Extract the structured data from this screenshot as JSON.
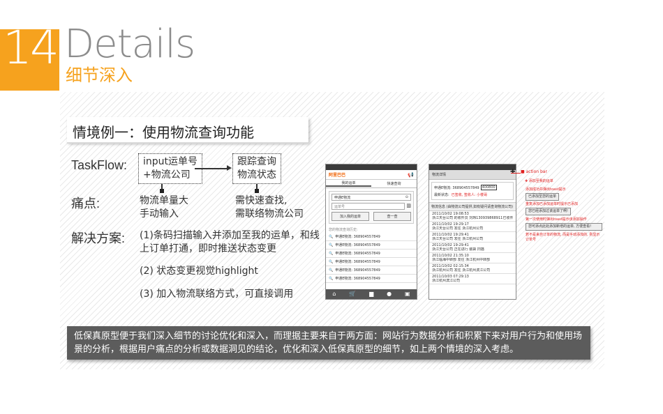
{
  "header": {
    "number": "14",
    "title_en": "Details",
    "title_cn": "细节深入"
  },
  "scenario": {
    "title": "情境例一：使用物流查询功能"
  },
  "taskflow": {
    "label": "TaskFlow:",
    "step1_line1": "input运单号",
    "step1_line2": "+物流公司",
    "step2_line1": "跟踪查询",
    "step2_line2": "物流状态"
  },
  "pain": {
    "label": "痛点:",
    "item1_line1": "物流单量大",
    "item1_line2": "手动输入",
    "item2_line1": "需快速查找,",
    "item2_line2": "需联络物流公司"
  },
  "solution": {
    "label": "解决方案:",
    "item1_line1": "(1)条码扫描输入并添加至我的运单，和线",
    "item1_line2": "上订单打通，即时推送状态变更",
    "item2": "(2) 状态变更视觉highlight",
    "item3": "(3) 加入物流联络方式，可直接调用"
  },
  "phone1": {
    "logo": "阿里巴巴",
    "tab1": "我的运单",
    "tab2": "快速查询",
    "select_label": "申通E物流",
    "input_placeholder": "运单号",
    "add_button": "加入我的运单",
    "query_button": "查一查",
    "history_label": "您的物流查询历史:",
    "history": [
      "申通E物流: 368904557849",
      "申通E物流: 368904557849",
      "申通E物流: 368904557849",
      "申通E物流: 368904557849",
      "申通E物流: 368904557849",
      "申通E物流: 368904557849"
    ],
    "nav_icons": [
      "home-icon",
      "cart-icon",
      "truck-icon",
      "circle-icon",
      "folder-icon"
    ]
  },
  "phone2": {
    "title": "物流详情",
    "waybill_line": "申通E物流: 368904557849",
    "phone_tag": "400800",
    "status_label": "最新状态:",
    "status_value": "已签收, 签收人: 小楼哥",
    "info_label": "物流信息 (由物流公司提供,如有疑问请查询物流公司)",
    "records": [
      {
        "time": "2011/10/02 19:08:53",
        "text": "浙江天台公司 的收件员 刘玮130939868911已收件"
      },
      {
        "time": "2011/10/02 19:29:17",
        "text": "浙江天台公司 发往 浙江杭州公司"
      },
      {
        "time": "2011/10/02 19:29:41",
        "text": "浙江天台公司 发往 浙江杭州公司"
      },
      {
        "time": "2011/10/02 19:29:41",
        "text": "浙江天台公司 正在进行 装袋 扫描"
      },
      {
        "time": "2011/10/02 21:35:10",
        "text": "浙江临海中转部 发往 浙江杭州中转部"
      },
      {
        "time": "2011/10/02 02:15:34",
        "text": "浙江杭州公司 发往 浙江杭州滨江公司"
      },
      {
        "time": "2011/10/03 07:29:13",
        "text": "浙江杭州滨江公司"
      }
    ]
  },
  "annotations": {
    "action_bar": "action bar",
    "add_waybill": "添加至我的运单",
    "toast_label": "添加成功并弹出toast提示",
    "toast_text": "已添加至您的运单",
    "repeat_label": "重复添加已添加运单时提示已添加",
    "repeat_text": "您已经添加过该运单了啊!",
    "first_label": "第一次使用时弹出toast提示该添加操作",
    "first_text": "您可添点此处添加新增的运单, 方便查看!",
    "not_added": "若不是来自订单的物流, 而是手动添加的, 则显示订单号"
  },
  "note": {
    "text": "低保真原型便于我们深入细节的讨论优化和深入，而理据主要来自于两方面：网站行为数据分析和积累下来对用户行为和使用场景的分析，根据用户痛点的分析或数据洞见的结论，优化和深入低保真原型的细节，如上两个情境的深入考虑。"
  },
  "colors": {
    "accent": "#f6a21e",
    "annotation_red": "#e02020",
    "note_bg": "#5c5c5c"
  }
}
